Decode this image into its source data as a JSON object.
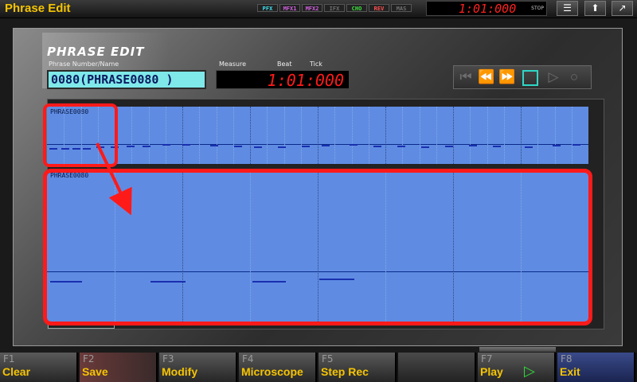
{
  "app": {
    "title": "Phrase Edit"
  },
  "status_bar": {
    "fx": [
      {
        "label": "PFX",
        "color": "#3fe0f0"
      },
      {
        "label": "MFX1",
        "color": "#d060e0"
      },
      {
        "label": "MFX2",
        "color": "#d060e0"
      },
      {
        "label": "IFX",
        "color": "#707070"
      },
      {
        "label": "CHO",
        "color": "#40e040"
      },
      {
        "label": "REV",
        "color": "#ff5050"
      },
      {
        "label": "MAS",
        "color": "#707070"
      }
    ],
    "song_position": "1:01:000",
    "transport_state": "STOP",
    "buttons": [
      {
        "name": "list",
        "glyph": "☰"
      },
      {
        "name": "up",
        "glyph": "⬆"
      },
      {
        "name": "external",
        "glyph": "↗"
      }
    ]
  },
  "editor": {
    "page_title": "PHRASE EDIT",
    "phrase_label": "Phrase Number/Name",
    "phrase_value": "0080(PHRASE0080   )",
    "position_labels": {
      "measure": "Measure",
      "beat": "Beat",
      "tick": "Tick"
    },
    "position_value": "1:01:000",
    "transport": [
      "rewind-start",
      "rewind",
      "fast-forward",
      "stop",
      "play",
      "record"
    ],
    "accent_color": "#2fd6c6"
  },
  "tracks": {
    "overview": {
      "label": "PHRASE0080",
      "measures": 8,
      "beats_per_measure": 4
    },
    "detail": {
      "label": "PHRASE0080",
      "measures": 4,
      "beats_per_measure": 2
    }
  },
  "function_keys": [
    {
      "key": "F1",
      "label": "Clear"
    },
    {
      "key": "F2",
      "label": "Save"
    },
    {
      "key": "F3",
      "label": "Modify"
    },
    {
      "key": "F4",
      "label": "Microscope"
    },
    {
      "key": "F5",
      "label": "Step Rec"
    },
    {
      "key": "",
      "label": ""
    },
    {
      "key": "F7",
      "label": "Play"
    },
    {
      "key": "F8",
      "label": "Exit"
    }
  ],
  "play_glyph": "▷"
}
